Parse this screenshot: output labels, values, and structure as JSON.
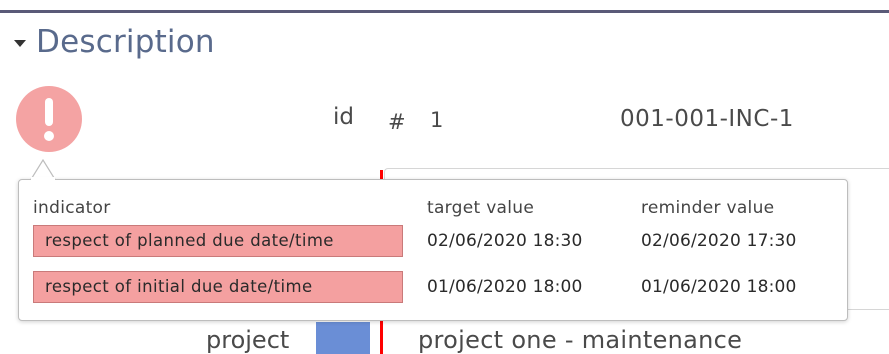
{
  "section": {
    "title": "Description"
  },
  "record": {
    "id_label": "id",
    "id_symbol": "#",
    "id_value": "1",
    "reference": "001-001-INC-1",
    "project_label": "project",
    "project_value": "project one - maintenance"
  },
  "status": {
    "icon": "exclamation-icon",
    "color": "#f4a3a3"
  },
  "tooltip": {
    "headers": {
      "indicator": "indicator",
      "target": "target value",
      "reminder": "reminder value"
    },
    "rows": [
      {
        "indicator": "respect of planned due date/time",
        "target": "02/06/2020 18:30",
        "reminder": "02/06/2020 17:30"
      },
      {
        "indicator": "respect of initial due date/time",
        "target": "01/06/2020 18:00",
        "reminder": "01/06/2020 18:00"
      }
    ],
    "indicator_color": "#f4a0a0"
  },
  "colors": {
    "section_title": "#596a8c",
    "top_rule": "#5a5a78",
    "project_swatch": "#6a8ed6",
    "required_bar": "#ff0000"
  }
}
